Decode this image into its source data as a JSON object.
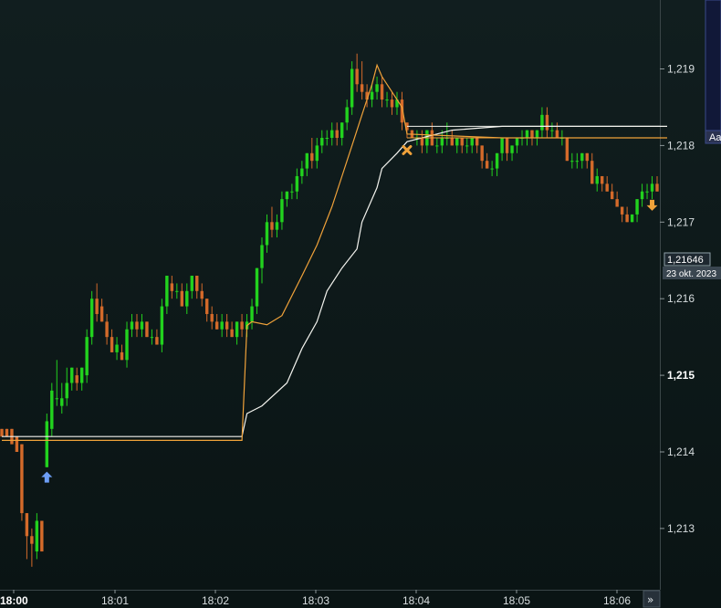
{
  "chart_data": {
    "type": "candlestick",
    "y_axis": {
      "ticks": [
        {
          "value": 1.213,
          "label": "1,213"
        },
        {
          "value": 1.214,
          "label": "1,214"
        },
        {
          "value": 1.215,
          "label": "1,215",
          "bold": true
        },
        {
          "value": 1.216,
          "label": "1,216"
        },
        {
          "value": 1.217,
          "label": "1,217"
        },
        {
          "value": 1.218,
          "label": "1,218"
        },
        {
          "value": 1.219,
          "label": "1,219"
        }
      ],
      "range": [
        1.2122,
        1.2199
      ]
    },
    "x_axis": {
      "ticks": [
        {
          "label": "18:00",
          "bold": true
        },
        {
          "label": "18:01"
        },
        {
          "label": "18:02"
        },
        {
          "label": "18:03"
        },
        {
          "label": "18:04"
        },
        {
          "label": "18:05"
        },
        {
          "label": "18:06"
        }
      ]
    },
    "current_price": {
      "value": 1.21646,
      "label": "1,21646",
      "date": "23 okt. 2023"
    },
    "colors": {
      "up": "#22d21e",
      "down": "#d46a2a",
      "background": "#0f1a1b",
      "vwap": "#f3f3ee",
      "trend": "#f0a23a"
    },
    "candles": [
      [
        1.2143,
        1.2143,
        1.2142,
        1.2142
      ],
      [
        1.2143,
        1.2143,
        1.2142,
        1.2142
      ],
      [
        1.2143,
        1.2143,
        1.2141,
        1.2141
      ],
      [
        1.2142,
        1.2142,
        1.214,
        1.214
      ],
      [
        1.2141,
        1.2141,
        1.2131,
        1.2132
      ],
      [
        1.2132,
        1.2132,
        1.2126,
        1.2129
      ],
      [
        1.2129,
        1.213,
        1.2125,
        1.2128
      ],
      [
        1.2127,
        1.2132,
        1.2126,
        1.2131
      ],
      [
        1.2131,
        1.2131,
        1.2127,
        1.2127
      ],
      [
        1.2138,
        1.2145,
        1.2138,
        1.2144
      ],
      [
        1.2143,
        1.2149,
        1.2142,
        1.2148
      ],
      [
        1.2147,
        1.2152,
        1.2146,
        1.2147
      ],
      [
        1.2146,
        1.2149,
        1.2145,
        1.2147
      ],
      [
        1.2147,
        1.2151,
        1.2146,
        1.2149
      ],
      [
        1.2149,
        1.2151,
        1.2148,
        1.2151
      ],
      [
        1.215,
        1.2151,
        1.2148,
        1.2149
      ],
      [
        1.2149,
        1.2151,
        1.2148,
        1.2151
      ],
      [
        1.215,
        1.2156,
        1.2149,
        1.2155
      ],
      [
        1.2155,
        1.2161,
        1.2154,
        1.216
      ],
      [
        1.216,
        1.2162,
        1.2157,
        1.2158
      ],
      [
        1.2159,
        1.216,
        1.2157,
        1.2157
      ],
      [
        1.2157,
        1.2158,
        1.2154,
        1.2155
      ],
      [
        1.2155,
        1.2156,
        1.2153,
        1.2153
      ],
      [
        1.2153,
        1.2155,
        1.2152,
        1.2154
      ],
      [
        1.2153,
        1.2154,
        1.2152,
        1.2152
      ],
      [
        1.2152,
        1.2157,
        1.2151,
        1.2156
      ],
      [
        1.2156,
        1.2158,
        1.2155,
        1.2157
      ],
      [
        1.2157,
        1.2158,
        1.2155,
        1.2156
      ],
      [
        1.2156,
        1.2158,
        1.2155,
        1.2157
      ],
      [
        1.2157,
        1.2157,
        1.2155,
        1.2155
      ],
      [
        1.2155,
        1.2156,
        1.2154,
        1.2155
      ],
      [
        1.2155,
        1.2156,
        1.2154,
        1.2154
      ],
      [
        1.2154,
        1.216,
        1.2153,
        1.2159
      ],
      [
        1.2159,
        1.2163,
        1.2158,
        1.2163
      ],
      [
        1.2162,
        1.2163,
        1.216,
        1.2161
      ],
      [
        1.2161,
        1.2162,
        1.216,
        1.2161
      ],
      [
        1.2161,
        1.2162,
        1.2159,
        1.2159
      ],
      [
        1.2159,
        1.2162,
        1.2158,
        1.2161
      ],
      [
        1.2161,
        1.2163,
        1.216,
        1.2163
      ],
      [
        1.2163,
        1.2163,
        1.216,
        1.2161
      ],
      [
        1.2161,
        1.2162,
        1.2159,
        1.216
      ],
      [
        1.216,
        1.216,
        1.2157,
        1.2158
      ],
      [
        1.2158,
        1.2159,
        1.2156,
        1.2157
      ],
      [
        1.2157,
        1.2158,
        1.2156,
        1.2156
      ],
      [
        1.2156,
        1.2158,
        1.2155,
        1.2157
      ],
      [
        1.2157,
        1.2158,
        1.2155,
        1.2156
      ],
      [
        1.2156,
        1.2157,
        1.2155,
        1.2155
      ],
      [
        1.2155,
        1.2157,
        1.2154,
        1.2157
      ],
      [
        1.2157,
        1.2158,
        1.2155,
        1.2156
      ],
      [
        1.2156,
        1.2158,
        1.2155,
        1.2157
      ],
      [
        1.2157,
        1.216,
        1.2156,
        1.2159
      ],
      [
        1.2159,
        1.2164,
        1.2158,
        1.2164
      ],
      [
        1.2164,
        1.2168,
        1.2162,
        1.2167
      ],
      [
        1.2167,
        1.2171,
        1.2166,
        1.217
      ],
      [
        1.217,
        1.2172,
        1.2168,
        1.2169
      ],
      [
        1.2169,
        1.2171,
        1.2168,
        1.217
      ],
      [
        1.217,
        1.2174,
        1.2169,
        1.2173
      ],
      [
        1.2173,
        1.2174,
        1.2172,
        1.2174
      ],
      [
        1.2174,
        1.2175,
        1.2173,
        1.2174
      ],
      [
        1.2174,
        1.2177,
        1.2173,
        1.2176
      ],
      [
        1.2176,
        1.2178,
        1.2175,
        1.2177
      ],
      [
        1.2177,
        1.2179,
        1.2176,
        1.2179
      ],
      [
        1.2179,
        1.2181,
        1.2177,
        1.2178
      ],
      [
        1.2178,
        1.2181,
        1.2177,
        1.218
      ],
      [
        1.218,
        1.2182,
        1.2179,
        1.2181
      ],
      [
        1.2181,
        1.2182,
        1.218,
        1.2181
      ],
      [
        1.2181,
        1.2183,
        1.218,
        1.2182
      ],
      [
        1.2182,
        1.2183,
        1.218,
        1.2181
      ],
      [
        1.2181,
        1.2183,
        1.218,
        1.2183
      ],
      [
        1.2183,
        1.2186,
        1.2182,
        1.2185
      ],
      [
        1.2185,
        1.2191,
        1.2184,
        1.219
      ],
      [
        1.219,
        1.2192,
        1.2187,
        1.2188
      ],
      [
        1.2188,
        1.2191,
        1.2186,
        1.2187
      ],
      [
        1.2187,
        1.2188,
        1.2185,
        1.2186
      ],
      [
        1.2186,
        1.2188,
        1.2185,
        1.2187
      ],
      [
        1.2187,
        1.2189,
        1.2186,
        1.2188
      ],
      [
        1.2188,
        1.2189,
        1.2185,
        1.2186
      ],
      [
        1.2186,
        1.2187,
        1.2185,
        1.2186
      ],
      [
        1.2186,
        1.2187,
        1.2184,
        1.2185
      ],
      [
        1.2185,
        1.2187,
        1.2184,
        1.2186
      ],
      [
        1.2186,
        1.2187,
        1.2182,
        1.2183
      ],
      [
        1.2183,
        1.2183,
        1.2181,
        1.2182
      ],
      [
        1.2182,
        1.2182,
        1.2181,
        1.2181
      ],
      [
        1.2181,
        1.2182,
        1.218,
        1.2181
      ],
      [
        1.2181,
        1.2182,
        1.2179,
        1.218
      ],
      [
        1.218,
        1.2182,
        1.2179,
        1.2182
      ],
      [
        1.2182,
        1.2183,
        1.218,
        1.218
      ],
      [
        1.218,
        1.2181,
        1.2179,
        1.218
      ],
      [
        1.218,
        1.2182,
        1.2179,
        1.2181
      ],
      [
        1.2181,
        1.2183,
        1.218,
        1.2181
      ],
      [
        1.2181,
        1.2182,
        1.218,
        1.218
      ],
      [
        1.218,
        1.2181,
        1.2179,
        1.2181
      ],
      [
        1.2181,
        1.2181,
        1.2179,
        1.218
      ],
      [
        1.218,
        1.2181,
        1.2179,
        1.218
      ],
      [
        1.218,
        1.2181,
        1.2179,
        1.2181
      ],
      [
        1.2181,
        1.2181,
        1.2179,
        1.218
      ],
      [
        1.218,
        1.218,
        1.2177,
        1.2178
      ],
      [
        1.2178,
        1.2179,
        1.2177,
        1.2177
      ],
      [
        1.2177,
        1.2178,
        1.2176,
        1.2177
      ],
      [
        1.2177,
        1.2179,
        1.2176,
        1.2179
      ],
      [
        1.2179,
        1.2181,
        1.2178,
        1.2181
      ],
      [
        1.2181,
        1.2181,
        1.2178,
        1.2179
      ],
      [
        1.2179,
        1.218,
        1.2178,
        1.218
      ],
      [
        1.218,
        1.2181,
        1.2179,
        1.2181
      ],
      [
        1.2181,
        1.2182,
        1.218,
        1.2181
      ],
      [
        1.2181,
        1.2182,
        1.218,
        1.2182
      ],
      [
        1.2182,
        1.2182,
        1.218,
        1.2181
      ],
      [
        1.2181,
        1.2182,
        1.218,
        1.2182
      ],
      [
        1.2182,
        1.2185,
        1.2181,
        1.2184
      ],
      [
        1.2184,
        1.2185,
        1.2181,
        1.2182
      ],
      [
        1.2182,
        1.2183,
        1.2181,
        1.2182
      ],
      [
        1.2182,
        1.2183,
        1.2181,
        1.2181
      ],
      [
        1.2181,
        1.2182,
        1.218,
        1.2181
      ],
      [
        1.2181,
        1.2181,
        1.2178,
        1.2178
      ],
      [
        1.2178,
        1.2179,
        1.2177,
        1.2178
      ],
      [
        1.2178,
        1.2179,
        1.2177,
        1.2178
      ],
      [
        1.2178,
        1.2179,
        1.2177,
        1.2179
      ],
      [
        1.2179,
        1.2179,
        1.2177,
        1.2178
      ],
      [
        1.2178,
        1.2179,
        1.2175,
        1.2175
      ],
      [
        1.2175,
        1.2177,
        1.2174,
        1.2176
      ],
      [
        1.2176,
        1.2176,
        1.2174,
        1.2175
      ],
      [
        1.2175,
        1.2176,
        1.2174,
        1.2174
      ],
      [
        1.2174,
        1.2175,
        1.2173,
        1.2173
      ],
      [
        1.2173,
        1.2174,
        1.2172,
        1.2172
      ],
      [
        1.2172,
        1.2172,
        1.217,
        1.2171
      ],
      [
        1.2171,
        1.2172,
        1.217,
        1.217
      ],
      [
        1.217,
        1.2171,
        1.217,
        1.2171
      ],
      [
        1.2171,
        1.2173,
        1.217,
        1.2173
      ],
      [
        1.2173,
        1.2175,
        1.2172,
        1.2174
      ],
      [
        1.2174,
        1.2175,
        1.2173,
        1.2174
      ],
      [
        1.2174,
        1.2176,
        1.2173,
        1.2175
      ],
      [
        1.2175,
        1.2176,
        1.2174,
        1.2174
      ]
    ],
    "markers": [
      {
        "kind": "buy-arrow",
        "index": 9,
        "value": 1.21367,
        "color": "#6d9ef5"
      },
      {
        "kind": "exit-cross",
        "index": 81,
        "value": 1.21794,
        "color": "#f0a23a"
      },
      {
        "kind": "sell-arrow",
        "index": 130,
        "value": 1.21722,
        "color": "#f0a23a"
      }
    ],
    "vwap_line": [
      [
        0,
        1.2142
      ],
      [
        48,
        1.2142
      ],
      [
        49,
        1.2145
      ],
      [
        52,
        1.2146
      ],
      [
        57,
        1.2149
      ],
      [
        60,
        1.21535
      ],
      [
        63,
        1.2157
      ],
      [
        65,
        1.2161
      ],
      [
        68,
        1.2164
      ],
      [
        71,
        1.21665
      ],
      [
        72,
        1.217
      ],
      [
        75,
        1.21745
      ],
      [
        76,
        1.2177
      ],
      [
        79,
        1.2179
      ],
      [
        81,
        1.21805
      ],
      [
        84,
        1.2181
      ],
      [
        87,
        1.21815
      ],
      [
        90,
        1.2182
      ],
      [
        100,
        1.21825
      ],
      [
        110,
        1.21825
      ],
      [
        120,
        1.21825
      ],
      [
        133,
        1.21825
      ]
    ],
    "trend_line": [
      [
        0,
        1.21415
      ],
      [
        48,
        1.21415
      ],
      [
        49,
        1.21565
      ],
      [
        50,
        1.2157
      ],
      [
        53,
        1.21566
      ],
      [
        56,
        1.21578
      ],
      [
        60,
        1.2163
      ],
      [
        63,
        1.2167
      ],
      [
        66,
        1.2172
      ],
      [
        68,
        1.2176
      ],
      [
        70,
        1.218
      ],
      [
        72,
        1.2184
      ],
      [
        74,
        1.2188
      ],
      [
        75,
        1.21905
      ],
      [
        76,
        1.2189
      ],
      [
        78,
        1.2187
      ],
      [
        80,
        1.2185
      ],
      [
        81,
        1.21815
      ],
      [
        100,
        1.2181
      ],
      [
        120,
        1.2181
      ],
      [
        133,
        1.2181
      ]
    ]
  },
  "side_panel": {
    "label": "Aa",
    "background": "#111838",
    "border": "#3a4a8a"
  },
  "scroll_button": {
    "label": "»"
  }
}
